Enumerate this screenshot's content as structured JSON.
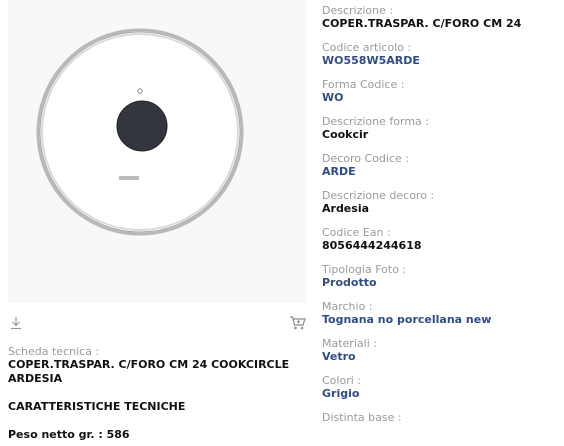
{
  "product": {
    "image_alt": "",
    "brand_mark": "Tognana"
  },
  "actions": {
    "download_icon": "download-icon",
    "cart_icon": "cart-icon"
  },
  "technical_sheet": {
    "label": "Scheda tecnica :",
    "title": "COPER.TRASPAR. C/FORO CM 24 COOKCIRCLE ARDESIA",
    "heading": "CARATTERISTICHE TECNICHE",
    "weight": "Peso netto gr. : 586"
  },
  "fields": [
    {
      "label": "Descrizione :",
      "value": "COPER.TRASPAR. C/FORO CM 24",
      "style": "dark"
    },
    {
      "label": "Codice articolo :",
      "value": "WO558W5ARDE",
      "style": "blue"
    },
    {
      "label": "Forma Codice :",
      "value": "WO",
      "style": "blue"
    },
    {
      "label": "Descrizione forma :",
      "value": "Cookcir",
      "style": "dark"
    },
    {
      "label": "Decoro Codice :",
      "value": "ARDE",
      "style": "blue"
    },
    {
      "label": "Descrizione decoro :",
      "value": "Ardesia",
      "style": "dark"
    },
    {
      "label": "Codice Ean :",
      "value": "8056444244618",
      "style": "dark"
    },
    {
      "label": "Tipologia Foto :",
      "value": "Prodotto",
      "style": "blue"
    },
    {
      "label": "Marchio :",
      "value": "Tognana no porcellana new",
      "style": "blue"
    },
    {
      "label": "Materiali :",
      "value": "Vetro",
      "style": "blue"
    },
    {
      "label": "Colori :",
      "value": "Grigio",
      "style": "blue"
    },
    {
      "label": "Distinta base :",
      "value": "",
      "style": "dark"
    }
  ],
  "colors": {
    "label_gray": "#9b9b9b",
    "value_blue": "#2f4d83",
    "value_dark": "#111111"
  }
}
